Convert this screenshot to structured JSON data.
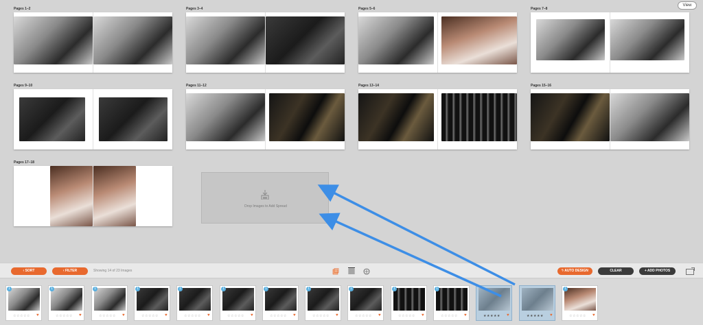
{
  "header": {
    "view_label": "View"
  },
  "spreads": [
    {
      "label": "Pages 1–2",
      "left": "light",
      "right": "light"
    },
    {
      "label": "Pages 3–4",
      "left": "light",
      "right": "dark"
    },
    {
      "label": "Pages 5–6",
      "left": "light",
      "right": "warm"
    },
    {
      "label": "Pages 7–8",
      "left": "light",
      "right": "light"
    },
    {
      "label": "Pages 9–10",
      "left": "dark",
      "right": "dark"
    },
    {
      "label": "Pages 11–12",
      "left": "light",
      "right": "city"
    },
    {
      "label": "Pages 13–14",
      "left": "city",
      "right": "bw"
    },
    {
      "label": "Pages 15–16",
      "left": "city",
      "right": "light"
    },
    {
      "label": "Pages 17–18",
      "left": "warm",
      "right": "warm"
    }
  ],
  "dropzone": {
    "text": "Drop Images to Add Spread"
  },
  "toolbar": {
    "sort_label": "SORT",
    "filter_label": "FILTER",
    "count_text": "Showing 14 of 23 Images",
    "auto_design_label": "AUTO DESIGN",
    "clear_label": "CLEAR",
    "add_photos_label": "+ ADD PHOTOS"
  },
  "tray": {
    "stars": "☆☆☆☆☆",
    "stars_filled": "★★★★★",
    "heart": "♥",
    "thumbs": [
      {
        "badge": "1",
        "tone": "light",
        "selected": false
      },
      {
        "badge": "1",
        "tone": "light",
        "selected": false
      },
      {
        "badge": "1",
        "tone": "light",
        "selected": false
      },
      {
        "badge": "1",
        "tone": "dark",
        "selected": false
      },
      {
        "badge": "1",
        "tone": "dark",
        "selected": false
      },
      {
        "badge": "1",
        "tone": "dark",
        "selected": false
      },
      {
        "badge": "1",
        "tone": "dark",
        "selected": false
      },
      {
        "badge": "1",
        "tone": "dark",
        "selected": false
      },
      {
        "badge": "1",
        "tone": "dark",
        "selected": false
      },
      {
        "badge": "1",
        "tone": "bw",
        "selected": false
      },
      {
        "badge": "1",
        "tone": "bw",
        "selected": false
      },
      {
        "badge": "",
        "tone": "blue",
        "selected": true
      },
      {
        "badge": "",
        "tone": "blue",
        "selected": true
      },
      {
        "badge": "1",
        "tone": "warm",
        "selected": false
      }
    ]
  },
  "colors": {
    "accent": "#e8692e",
    "arrow": "#3d8ee6",
    "badge": "#5ab0e0"
  }
}
